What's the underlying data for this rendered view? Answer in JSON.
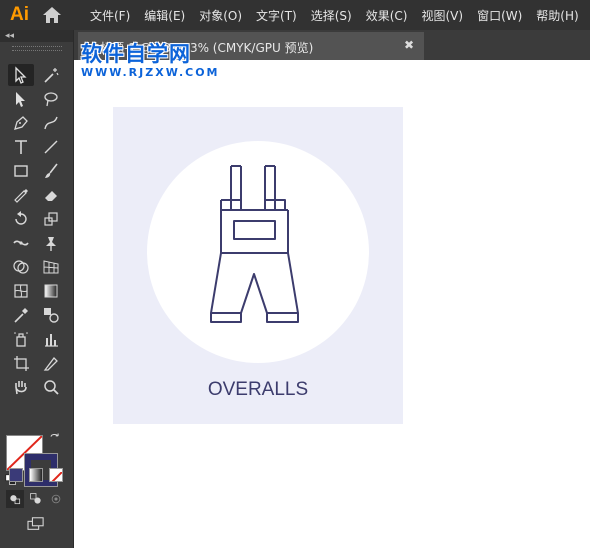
{
  "app": {
    "logo": "Ai"
  },
  "menu": [
    "文件(F)",
    "编辑(E)",
    "对象(O)",
    "文字(T)",
    "选择(S)",
    "效果(C)",
    "视图(V)",
    "窗口(W)",
    "帮助(H)"
  ],
  "document_tab": {
    "title": "未标题-1 @ 133.33% (CMYK/GPU 预览)",
    "close": "✖"
  },
  "toolbar": {
    "collapse_glyph": "◂◂"
  },
  "artboard": {
    "label": "OVERALLS",
    "background_color": "#ecedf8",
    "icon_color": "#3c3c6d"
  },
  "watermark": {
    "chinese": "软件自学网",
    "url": "WWW.RJZXW.COM"
  },
  "colors": {
    "fill": "#ffffff",
    "stroke": "#2e2e6a",
    "accent": "#ff9a00"
  }
}
